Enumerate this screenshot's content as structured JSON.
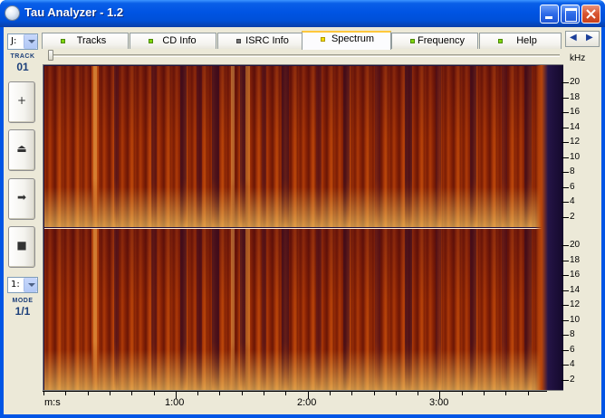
{
  "window": {
    "title": "Tau Analyzer - 1.2"
  },
  "left_panel": {
    "drive_value": "J:",
    "track_caption": "TRACK",
    "track_number": "01",
    "buttons": [
      {
        "name": "add",
        "glyph": "+"
      },
      {
        "name": "eject",
        "glyph": "⏏"
      },
      {
        "name": "play",
        "glyph": "➡"
      },
      {
        "name": "stop",
        "glyph": "■"
      }
    ],
    "mode_select_value": "1:",
    "mode_caption": "MODE",
    "mode_value": "1/1"
  },
  "tabs": [
    {
      "label": "Tracks",
      "led": "green"
    },
    {
      "label": "CD Info",
      "led": "green"
    },
    {
      "label": "ISRC Info",
      "led": "grey"
    },
    {
      "label": "Spectrum",
      "led": "yellow",
      "active": true
    },
    {
      "label": "Frequency",
      "led": "green"
    },
    {
      "label": "Help",
      "led": "green"
    }
  ],
  "tab_scroll": {
    "left": "◀",
    "right": "▶"
  },
  "spectrum": {
    "y_unit": "kHz",
    "y_ticks_top": [
      "20",
      "18",
      "16",
      "14",
      "12",
      "10",
      "8",
      "6",
      "4",
      "2"
    ],
    "y_ticks_bottom": [
      "20",
      "18",
      "16",
      "14",
      "12",
      "10",
      "8",
      "6",
      "4",
      "2"
    ],
    "x_unit": "m:s",
    "x_ticks": [
      "1:00",
      "2:00",
      "3:00"
    ],
    "colors": {
      "low": "#6a1606",
      "mid": "#b03c08",
      "high": "#ffe070",
      "background": "#20103c"
    }
  }
}
